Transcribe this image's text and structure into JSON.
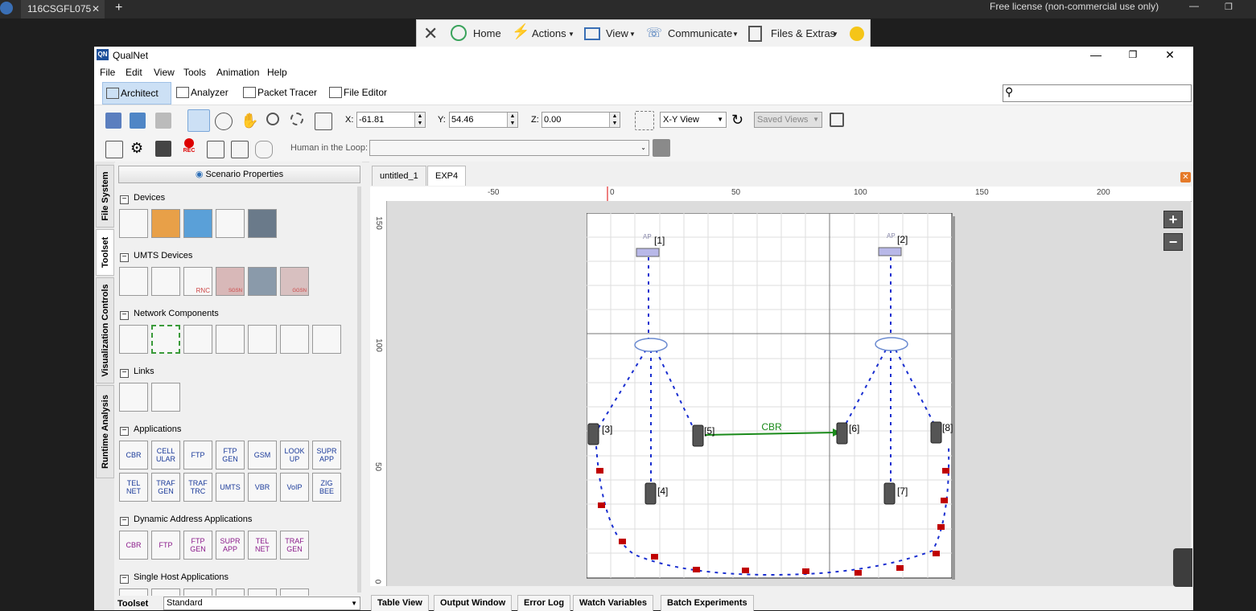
{
  "remote": {
    "tab_title": "116CSGFL075",
    "license": "Free license (non-commercial use only)"
  },
  "teamviewer": {
    "home": "Home",
    "actions": "Actions",
    "view": "View",
    "communicate": "Communicate",
    "files": "Files & Extras"
  },
  "app": {
    "title": "QualNet",
    "logo_text": "QN"
  },
  "menu": [
    "File",
    "Edit",
    "View",
    "Tools",
    "Animation",
    "Help"
  ],
  "modes": [
    "Architect",
    "Analyzer",
    "Packet Tracer",
    "File Editor"
  ],
  "coords": {
    "x_label": "X:",
    "x": "-61.81",
    "y_label": "Y:",
    "y": "54.46",
    "z_label": "Z:",
    "z": "0.00",
    "view": "X-Y View",
    "saved_views": "Saved Views"
  },
  "hitl": {
    "label": "Human in the Loop:",
    "rec": "REC"
  },
  "side_tabs": [
    "File System",
    "Toolset",
    "Visualization Controls",
    "Runtime Analysis"
  ],
  "toolset": {
    "scenario_props": "Scenario Properties",
    "sections": {
      "devices": "Devices",
      "umts": "UMTS Devices",
      "network": "Network Components",
      "links": "Links",
      "applications": "Applications",
      "dynamic": "Dynamic Address Applications",
      "single": "Single Host Applications"
    },
    "apps": [
      "CBR",
      "CELL ULAR",
      "FTP",
      "FTP GEN",
      "GSM",
      "LOOK UP",
      "SUPR APP",
      "TEL NET",
      "TRAF GEN",
      "TRAF TRC",
      "UMTS",
      "VBR",
      "VoIP",
      "ZIG BEE"
    ],
    "dyn_apps": [
      "CBR",
      "FTP",
      "FTP GEN",
      "SUPR APP",
      "TEL NET",
      "TRAF GEN"
    ],
    "footer_label": "Toolset",
    "footer_value": "Standard",
    "umts_labels": [
      "RNC",
      "SGSN",
      "GGSN"
    ]
  },
  "canvas": {
    "tabs": [
      "untitled_1",
      "EXP4"
    ],
    "hruler": [
      "-50",
      "0",
      "50",
      "100",
      "150",
      "200"
    ],
    "vruler": [
      "150",
      "100",
      "50",
      "0"
    ],
    "cbr_label": "CBR",
    "ap_label": "AP",
    "nodes": [
      "[1]",
      "[2]",
      "[3]",
      "[4]",
      "[5]",
      "[6]",
      "[7]",
      "[8]"
    ]
  },
  "bottom_tabs": [
    "Table View",
    "Output Window",
    "Error Log",
    "Watch Variables",
    "Batch Experiments"
  ],
  "colors": {
    "accent": "#1c4f9a",
    "link_green": "#1a8a1a",
    "mobility_blue": "#1a2fd0",
    "flag_red": "#c00000"
  }
}
